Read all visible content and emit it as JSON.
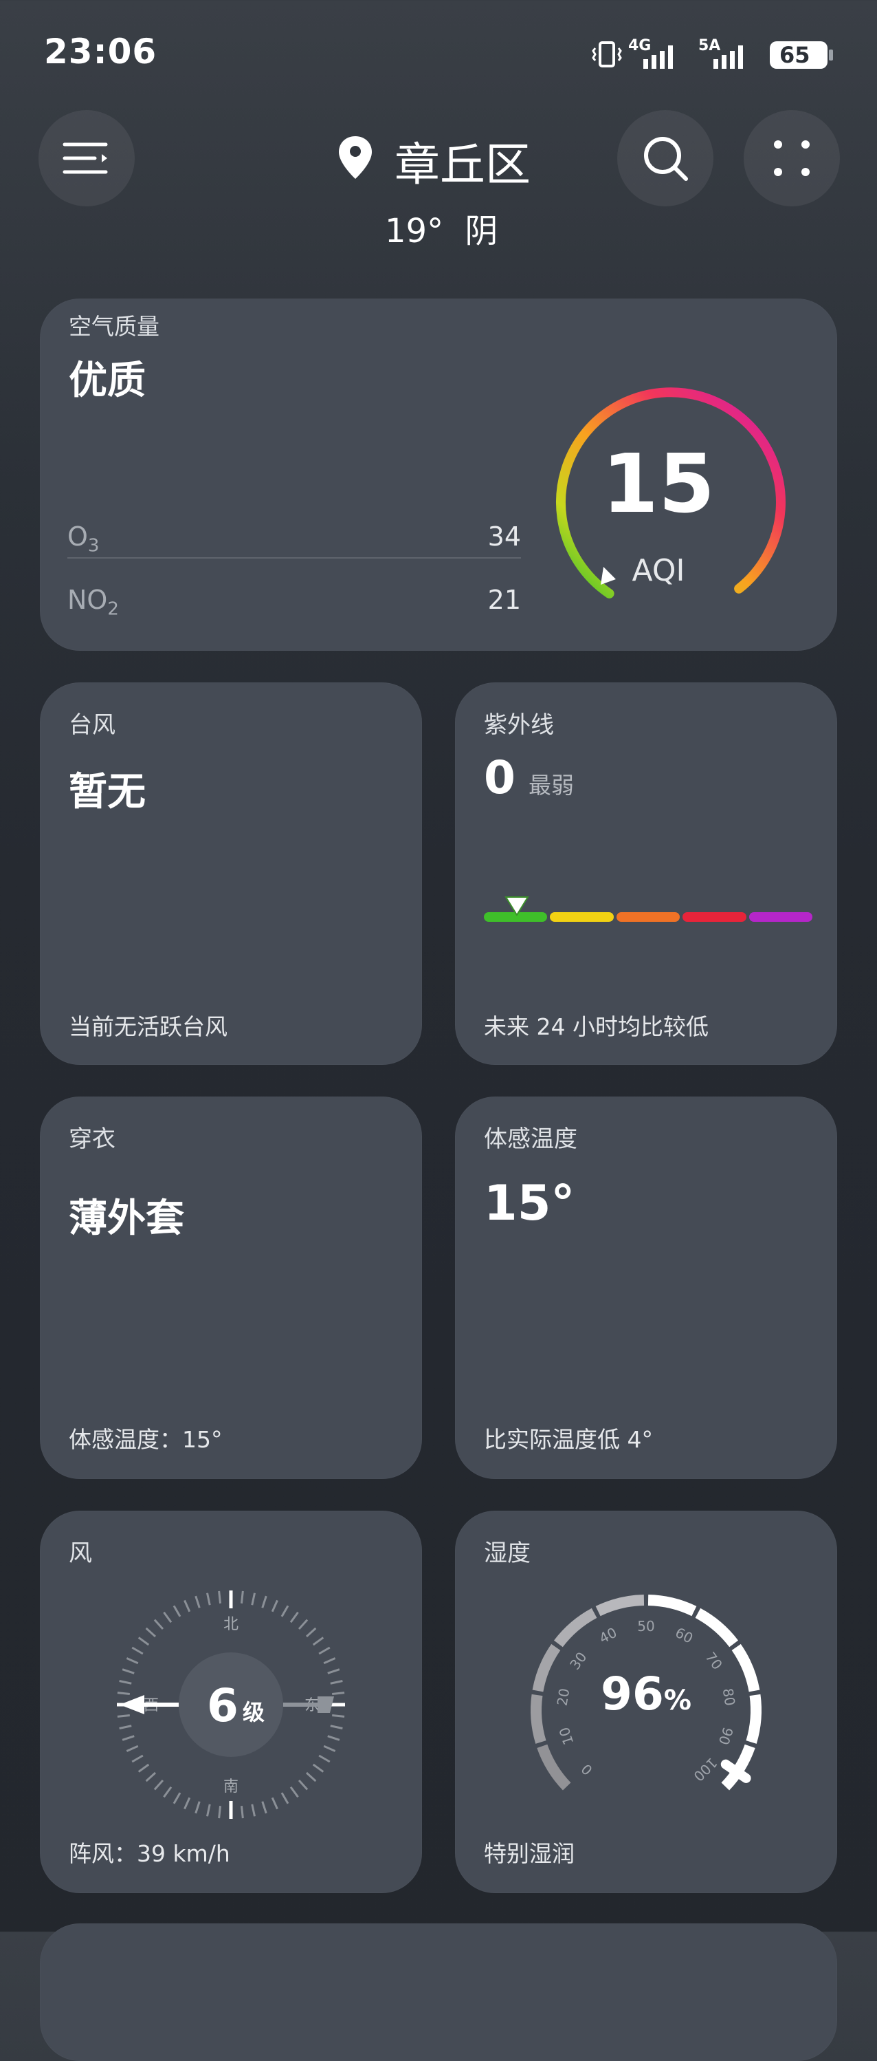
{
  "status_bar": {
    "time": "23:06",
    "net1": "4G",
    "net2": "5A",
    "battery": "65"
  },
  "header": {
    "location": "章丘区",
    "temp": "19°",
    "condition": "阴"
  },
  "air": {
    "title": "空气质量",
    "level": "优质",
    "o3_label": "O",
    "o3_sub": "3",
    "o3_value": "34",
    "no2_label": "NO",
    "no2_sub": "2",
    "no2_value": "21",
    "aqi": "15",
    "aqi_label": "AQI"
  },
  "typhoon": {
    "title": "台风",
    "value": "暂无",
    "footer": "当前无活跃台风"
  },
  "uv": {
    "title": "紫外线",
    "value": "0",
    "level": "最弱",
    "footer": "未来 24 小时均比较低",
    "colors": [
      "#3fbf2a",
      "#f2d213",
      "#f07226",
      "#e8243a",
      "#b526c9"
    ]
  },
  "clothing": {
    "title": "穿衣",
    "value": "薄外套",
    "footer": "体感温度：15°"
  },
  "feels_like": {
    "title": "体感温度",
    "value": "15°",
    "footer": "比实际温度低 4°"
  },
  "wind": {
    "title": "风",
    "level_num": "6",
    "level_unit": "级",
    "north": "北",
    "south": "南",
    "west": "西",
    "east": "东",
    "footer": "阵风：39 km/h"
  },
  "humidity": {
    "title": "湿度",
    "value": "96",
    "unit": "%",
    "footer": "特别湿润",
    "scale": [
      "0",
      "10",
      "20",
      "30",
      "40",
      "50",
      "60",
      "70",
      "80",
      "90",
      "100"
    ]
  }
}
